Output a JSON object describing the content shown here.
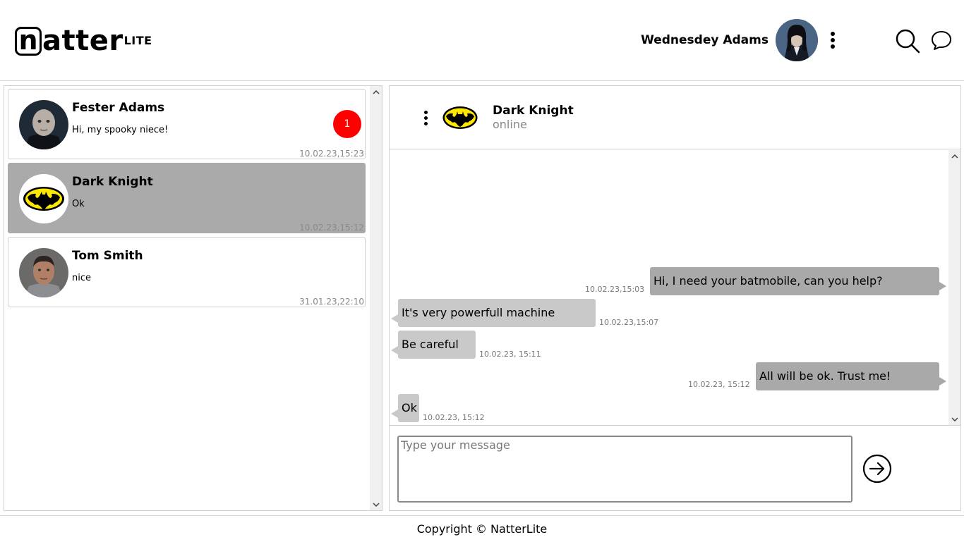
{
  "app": {
    "logo_letter": "n",
    "logo_rest": "atter",
    "logo_sup": "LITE"
  },
  "header": {
    "user_name": "Wednesdey Adams"
  },
  "contacts": [
    {
      "name": "Fester Adams",
      "last_message": "Hi, my spooky niece!",
      "time": "10.02.23,15:23",
      "unread": "1",
      "avatar": "fester-avatar"
    },
    {
      "name": "Dark Knight",
      "last_message": "Ok",
      "time": "10.02.23,15:12",
      "avatar": "batman-logo",
      "active": true
    },
    {
      "name": "Tom Smith",
      "last_message": "nice",
      "time": "31.01.23,22:10",
      "avatar": "tom-avatar"
    }
  ],
  "chat": {
    "contact_name": "Dark Knight",
    "status": "online",
    "messages": [
      {
        "direction": "out",
        "text": "Hi, I need your batmobile, can you help?",
        "time": "10.02.23,15:03"
      },
      {
        "direction": "in",
        "text": "It's very powerfull machine",
        "time": "10.02.23,15:07"
      },
      {
        "direction": "in",
        "text": "Be careful",
        "time": "10.02.23, 15:11"
      },
      {
        "direction": "out",
        "text": "All will be ok. Trust me!",
        "time": "10.02.23, 15:12"
      },
      {
        "direction": "in",
        "text": "Ok",
        "time": "10.02.23, 15:12"
      }
    ]
  },
  "composer": {
    "placeholder": "Type your message"
  },
  "footer": {
    "copyright": "Copyright © NatterLite"
  },
  "colors": {
    "active_contact": "#aaaaaa",
    "badge": "#ff0000",
    "outgoing_bubble": "#a9a9a9",
    "incoming_bubble": "#c9c9c9",
    "batman_yellow": "#ffe800"
  }
}
